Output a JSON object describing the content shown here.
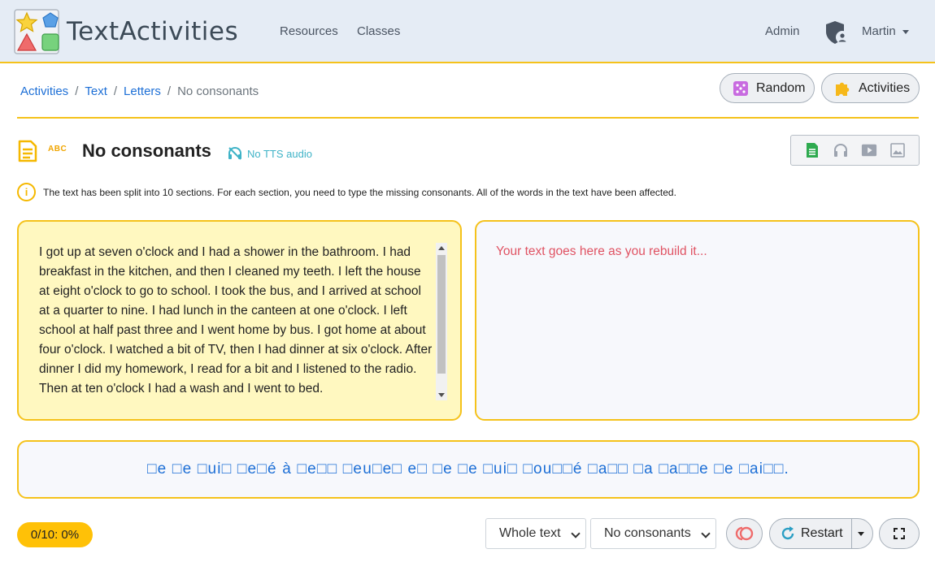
{
  "app": {
    "brand": "TextActivities"
  },
  "nav": {
    "links": [
      "Resources",
      "Classes"
    ],
    "admin": "Admin",
    "user": "Martin"
  },
  "breadcrumb": {
    "items": [
      "Activities",
      "Text",
      "Letters"
    ],
    "current": "No consonants"
  },
  "actions": {
    "random": "Random",
    "activities": "Activities"
  },
  "activity": {
    "badge": "ABC",
    "title": "No consonants",
    "tts": "No TTS audio",
    "info": "The text has been split into 10 sections. For each section, you need to type the missing consonants. All of the words in the text have been affected."
  },
  "source_text": "I got up at seven o'clock and I had a shower in the bathroom. I had breakfast in the kitchen, and then I cleaned my teeth. I left the house at eight o'clock to go to school. I took the bus, and I arrived at school at a quarter to nine. I had lunch in the canteen at one o'clock. I left school at half past three and I went home by bus. I got home at about four o'clock. I watched a bit of TV, then I had dinner at six o'clock. After dinner I did my homework, I read for a bit and I listened to the radio. Then at ten o'clock I had a wash and I went to bed.",
  "rebuild": {
    "placeholder": "Your text goes here as you rebuild it..."
  },
  "puzzle": {
    "text": "□e □e □ui□ □e□é à □e□□ □eu□e□ e□ □e □e □ui□ □ou□□é □a□□ □a □a□□e □e □ai□□."
  },
  "controls": {
    "score": "0/10: 0%",
    "scope_select": "Whole text",
    "mode_select": "No consonants",
    "restart": "Restart"
  },
  "colors": {
    "accent": "#f5c21b",
    "link": "#1d6fd6",
    "text_panel_bg": "#fff8c0",
    "placeholder": "#e05363",
    "score_badge": "#ffc107"
  }
}
